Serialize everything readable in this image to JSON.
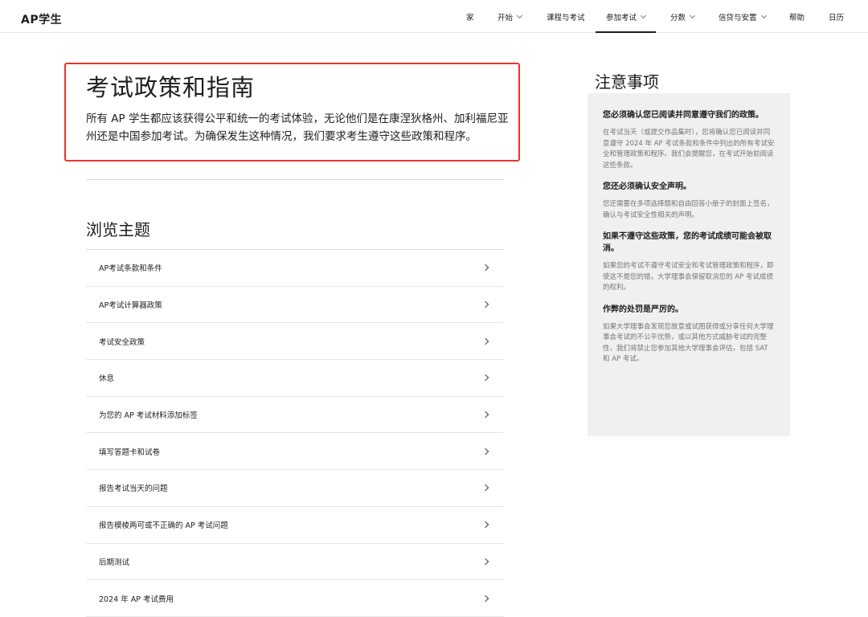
{
  "header": {
    "logo": "AP学生",
    "nav": [
      {
        "label": "家",
        "dropdown": false,
        "active": false
      },
      {
        "label": "开始",
        "dropdown": true,
        "active": false
      },
      {
        "label": "课程与考试",
        "dropdown": false,
        "active": false
      },
      {
        "label": "参加考试",
        "dropdown": true,
        "active": true
      },
      {
        "label": "分数",
        "dropdown": true,
        "active": false
      },
      {
        "label": "信贷与安置",
        "dropdown": true,
        "active": false
      },
      {
        "label": "帮助",
        "dropdown": false,
        "active": false
      },
      {
        "label": "日历",
        "dropdown": false,
        "active": false
      }
    ]
  },
  "main": {
    "title": "考试政策和指南",
    "intro": "所有 AP 学生都应该获得公平和统一的考试体验，无论他们是在康涅狄格州、加利福尼亚州还是中国参加考试。为确保发生这种情况，我们要求考生遵守这些政策和程序。",
    "browse_title": "浏览主题",
    "topics": [
      "AP考试条款和条件",
      "AP考试计算器政策",
      "考试安全政策",
      "休息",
      "为您的 AP 考试材料添加标签",
      "填写答题卡和试卷",
      "报告考试当天的问题",
      "报告模棱两可或不正确的 AP 考试问题",
      "后期测试",
      "2024 年 AP 考试费用"
    ]
  },
  "sidebar": {
    "heading": "注意事项",
    "notes": [
      {
        "title": "您必须确认您已阅读并同意遵守我们的政策。",
        "body": "在考试当天（或提交作品集时），您将确认您已阅读并同意遵守 2024 年 AP 考试条款和条件中列出的所有考试安全和管理政策和程序。我们会提醒您，在考试开始前阅读这些条款。"
      },
      {
        "title": "您还必须确认安全声明。",
        "body": "您还需要在多项选择题和自由回答小册子的封面上签名，确认与考试安全性相关的声明。"
      },
      {
        "title": "如果不遵守这些政策，您的考试成绩可能会被取消。",
        "body": "如果您的考试不遵守考试安全和考试管理政策和程序，即使这不是您的错，大学理事会保留取消您的 AP 考试成绩的权利。"
      },
      {
        "title": "作弊的处罚是严厉的。",
        "body": "如果大学理事会发现您故意或试图获得或分享任何大学理事会考试的不公平优势，或以其他方式威胁考试的完整性，我们将禁止您参加其他大学理事会评估，包括 SAT 和 AP 考试。"
      }
    ]
  },
  "colors": {
    "highlight_border": "#e8342c",
    "notes_background": "#f0f0f0",
    "note_body_text": "#767676"
  }
}
